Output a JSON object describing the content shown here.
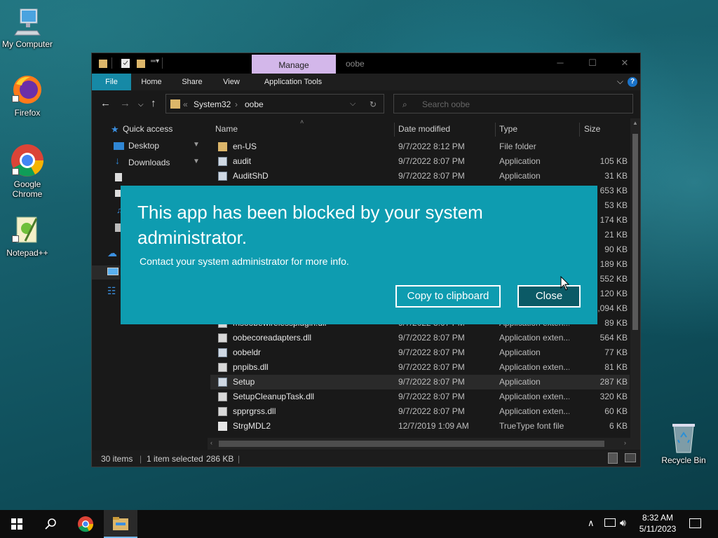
{
  "desktop": {
    "icons": [
      {
        "label": "My Computer"
      },
      {
        "label": "Firefox"
      },
      {
        "label": "Google Chrome"
      },
      {
        "label": "Notepad++"
      },
      {
        "label": "Recycle Bin"
      }
    ]
  },
  "window": {
    "contextual_tab": "Manage",
    "title": "oobe",
    "ribbon_tabs": [
      "File",
      "Home",
      "Share",
      "View",
      "Application Tools"
    ],
    "address": {
      "segments": [
        "System32",
        "oobe"
      ]
    },
    "search_placeholder": "Search oobe",
    "nav_pane": {
      "quick_access": "Quick access",
      "items": [
        "Desktop",
        "Downloads"
      ]
    },
    "columns": {
      "name": "Name",
      "date": "Date modified",
      "type": "Type",
      "size": "Size"
    },
    "files": [
      {
        "name": "en-US",
        "date": "9/7/2022 8:12 PM",
        "type": "File folder",
        "size": ""
      },
      {
        "name": "audit",
        "date": "9/7/2022 8:07 PM",
        "type": "Application",
        "size": "105 KB"
      },
      {
        "name": "AuditShD",
        "date": "9/7/2022 8:07 PM",
        "type": "Application",
        "size": "31 KB"
      },
      {
        "name": "",
        "date": "",
        "type": "",
        "size": "653 KB"
      },
      {
        "name": "",
        "date": "",
        "type": "",
        "size": "53 KB"
      },
      {
        "name": "",
        "date": "",
        "type": "",
        "size": "174 KB"
      },
      {
        "name": "",
        "date": "",
        "type": "",
        "size": "21 KB"
      },
      {
        "name": "",
        "date": "",
        "type": "",
        "size": "90 KB"
      },
      {
        "name": "",
        "date": "",
        "type": "",
        "size": "189 KB"
      },
      {
        "name": "",
        "date": "",
        "type": "",
        "size": "552 KB"
      },
      {
        "name": "",
        "date": "",
        "type": "",
        "size": "120 KB"
      },
      {
        "name": "",
        "date": "",
        "type": "",
        "size": "1,094 KB"
      },
      {
        "name": "msoobewirelessplugin.dll",
        "date": "9/7/2022 8:07 PM",
        "type": "Application exten...",
        "size": "89 KB"
      },
      {
        "name": "oobecoreadapters.dll",
        "date": "9/7/2022 8:07 PM",
        "type": "Application exten...",
        "size": "564 KB"
      },
      {
        "name": "oobeldr",
        "date": "9/7/2022 8:07 PM",
        "type": "Application",
        "size": "77 KB"
      },
      {
        "name": "pnpibs.dll",
        "date": "9/7/2022 8:07 PM",
        "type": "Application exten...",
        "size": "81 KB"
      },
      {
        "name": "Setup",
        "date": "9/7/2022 8:07 PM",
        "type": "Application",
        "size": "287 KB"
      },
      {
        "name": "SetupCleanupTask.dll",
        "date": "9/7/2022 8:07 PM",
        "type": "Application exten...",
        "size": "320 KB"
      },
      {
        "name": "spprgrss.dll",
        "date": "9/7/2022 8:07 PM",
        "type": "Application exten...",
        "size": "60 KB"
      },
      {
        "name": "StrgMDL2",
        "date": "12/7/2019 1:09 AM",
        "type": "TrueType font file",
        "size": "6 KB"
      }
    ],
    "status": {
      "items": "30 items",
      "selected": "1 item selected",
      "size": "286 KB"
    }
  },
  "dialog": {
    "title": "This app has been blocked by your system administrator.",
    "message": "Contact your system administrator for more info.",
    "copy_button": "Copy to clipboard",
    "close_button": "Close"
  },
  "taskbar": {
    "time": "8:32 AM",
    "date": "5/11/2023"
  },
  "colors": {
    "dialog_bg": "#0e9cb0",
    "close_button_bg": "#0b5a66",
    "manage_tab": "#d3b7ea",
    "file_tab": "#1689a6"
  }
}
